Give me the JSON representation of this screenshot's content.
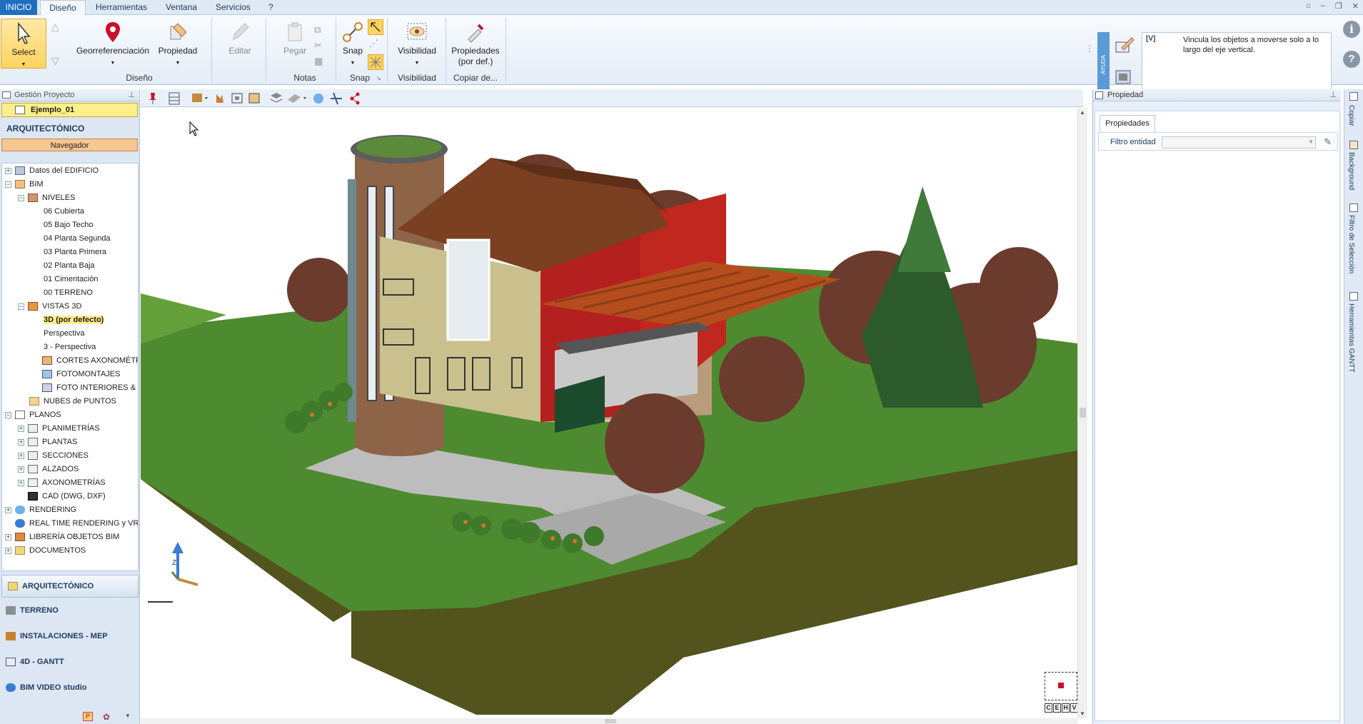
{
  "menubar": {
    "tabs": [
      "INICIO",
      "Diseño",
      "Herramientas",
      "Ventana",
      "Servicios",
      "?"
    ],
    "active_tab": "Diseño"
  },
  "ribbon": {
    "select": "Select",
    "georef": "Georreferenciación",
    "propiedad": "Propiedad",
    "editar": "Editar",
    "pegar": "Pegar",
    "snap": "Snap",
    "visibilidad": "Visibilidad",
    "propiedades_def_1": "Propiedades",
    "propiedades_def_2": "(por def.)",
    "groups": {
      "diseno": "Diseño",
      "notas": "Notas",
      "snap": "Snap",
      "visibilidad": "Visibilidad",
      "copiar": "Copiar de..."
    }
  },
  "help": {
    "tab": "AYUDA",
    "code": "[V]",
    "text": "Vincula los objetos a moverse solo a lo largo del eje vertical."
  },
  "left_panel": {
    "header": "Gestión Proyecto",
    "project": "Ejemplo_01",
    "section_title": "ARQUITECTÓNICO",
    "navigator": "Navegador",
    "tree": {
      "datos": "Datos del EDIFICIO",
      "bim": "BIM",
      "niveles": "NIVELES",
      "n06": "06 Cubierta",
      "n05": "05 Bajo Techo",
      "n04": "04 Planta Segunda",
      "n03": "03 Planta Primera",
      "n02": "02 Planta Baja",
      "n01": "01 Cimentación",
      "n00": "00 TERRENO",
      "vistas": "VISTAS 3D",
      "v3d": "3D (por defecto)",
      "persp": "Perspectiva",
      "persp3": "3 - Perspectiva",
      "cortes": "CORTES AXONOMÉTRICOS",
      "foto": "FOTOMONTAJES",
      "fotoint": "FOTO INTERIORES & EXTERIORES",
      "nubes": "NUBES de PUNTOS",
      "planos": "PLANOS",
      "planimetrias": "PLANIMETRÍAS",
      "plantas": "PLANTAS",
      "secciones": "SECCIONES",
      "alzados": "ALZADOS",
      "axonometrias": "AXONOMETRÍAS",
      "cad": "CAD (DWG, DXF)",
      "rendering": "RENDERING",
      "realtime": "REAL TIME RENDERING y VRI",
      "libreria": "LIBRERÍA OBJETOS BIM",
      "documentos": "DOCUMENTOS"
    },
    "modules": [
      "ARQUITECTÓNICO",
      "TERRENO",
      "INSTALACIONES - MEP",
      "4D - GANTT",
      "BIM VIDEO studio"
    ]
  },
  "viewport": {
    "axis_label": "Z",
    "view_buttons": [
      "C",
      "E",
      "H",
      "V"
    ]
  },
  "right_panel": {
    "header": "Propiedad",
    "tab": "Propiedades",
    "filter_label": "Filtro entidad",
    "filter_value": ""
  },
  "side_tabs": [
    "Copiar",
    "Background",
    "Filtro de Selección",
    "Herramientas GANTT"
  ],
  "colors": {
    "accent": "#1f6fc0",
    "selection": "#ffef8a",
    "navigator": "#f7c792"
  }
}
